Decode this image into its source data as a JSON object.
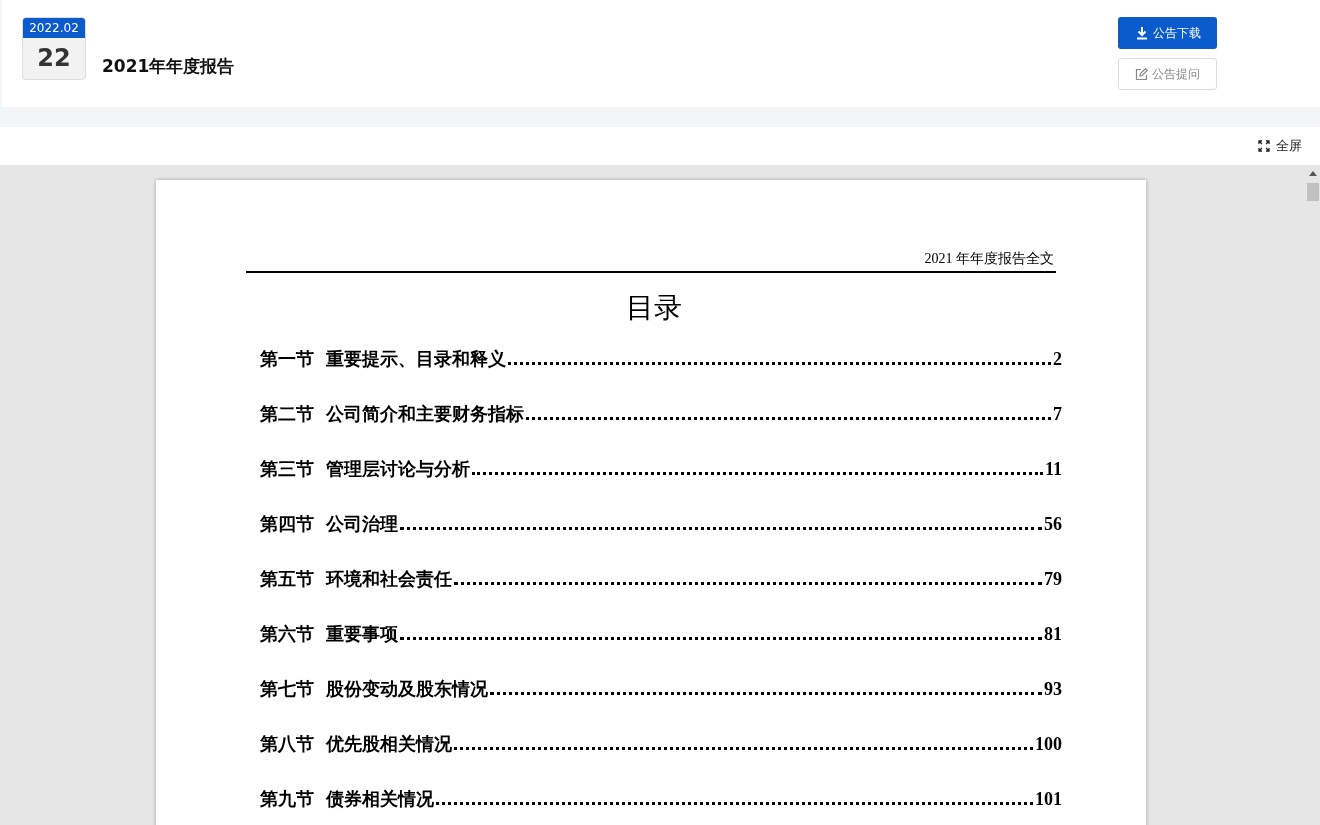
{
  "header": {
    "date_month": "2022.02",
    "date_day": "22",
    "title": "2021年年度报告",
    "buttons": [
      {
        "kind": "download",
        "label": "公告下载"
      },
      {
        "kind": "ask",
        "label": "公告提问"
      }
    ]
  },
  "toolbar": {
    "fullscreen": "全屏"
  },
  "document": {
    "running_head": "2021 年年度报告全文",
    "heading": "目录",
    "toc": [
      {
        "section": "第一节",
        "title": "重要提示、目录和释义",
        "page": "2"
      },
      {
        "section": "第二节",
        "title": "公司简介和主要财务指标",
        "page": "7"
      },
      {
        "section": "第三节",
        "title": "管理层讨论与分析",
        "page": "11"
      },
      {
        "section": "第四节",
        "title": "公司治理",
        "page": "56"
      },
      {
        "section": "第五节",
        "title": "环境和社会责任",
        "page": "79"
      },
      {
        "section": "第六节",
        "title": "重要事项",
        "page": "81"
      },
      {
        "section": "第七节",
        "title": "股份变动及股东情况",
        "page": "93"
      },
      {
        "section": "第八节",
        "title": "优先股相关情况",
        "page": "100"
      },
      {
        "section": "第九节",
        "title": "债券相关情况",
        "page": "101"
      }
    ]
  }
}
